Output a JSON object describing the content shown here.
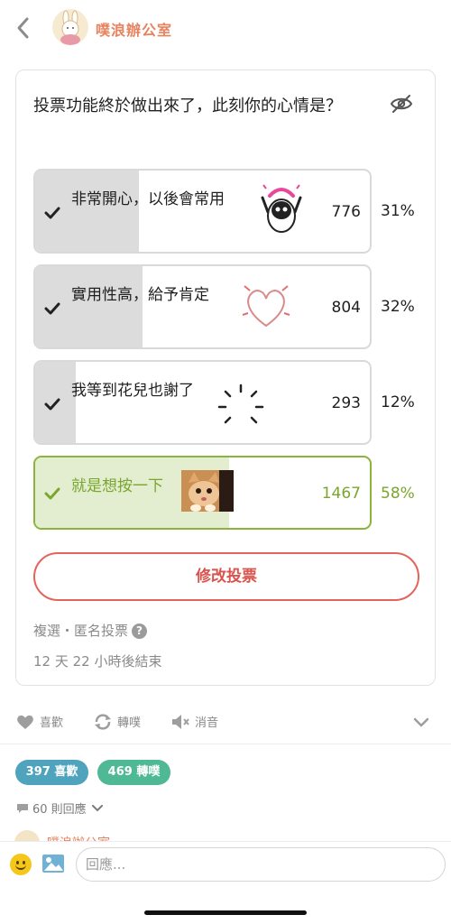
{
  "header": {
    "title": "噗浪辦公室"
  },
  "poll": {
    "question": "投票功能終於做出來了，此刻你的心情是？",
    "options": [
      {
        "label": "非常開心，以後會常用",
        "count": "776",
        "percent": "31%",
        "fraction": 0.31,
        "selected": false
      },
      {
        "label": "實用性高，給予肯定",
        "count": "804",
        "percent": "32%",
        "fraction": 0.32,
        "selected": false
      },
      {
        "label": "我等到花兒也謝了",
        "count": "293",
        "percent": "12%",
        "fraction": 0.12,
        "selected": false
      },
      {
        "label": "就是想按一下",
        "count": "1467",
        "percent": "58%",
        "fraction": 0.58,
        "selected": true
      }
    ],
    "edit_label": "修改投票",
    "meta": "複選・匿名投票",
    "ends": "12 天 22 小時後結束"
  },
  "actions": {
    "like": "喜歡",
    "replurk": "轉噗",
    "mute": "消音"
  },
  "stats": {
    "likes": "397 喜歡",
    "replurks": "469 轉噗"
  },
  "replies": {
    "label": "60 則回應"
  },
  "composer": {
    "placeholder": "回應..."
  },
  "colors": {
    "accent": "#e8825f",
    "selected": "#8db23d",
    "danger": "#e3645a",
    "likes_pill": "#4fa3bd",
    "replurks_pill": "#4fb894"
  }
}
